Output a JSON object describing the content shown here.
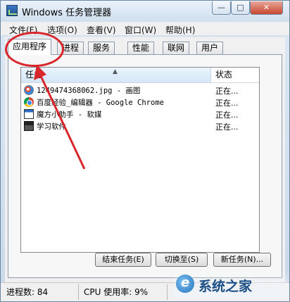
{
  "window": {
    "title": "Windows 任务管理器",
    "controls": {
      "minimize": "—",
      "maximize": "□",
      "close": "✕"
    }
  },
  "menubar": {
    "items": [
      "文件(F)",
      "选项(O)",
      "查看(V)",
      "窗口(W)",
      "帮助(H)"
    ]
  },
  "tabs": [
    "应用程序",
    "进程",
    "服务",
    "性能",
    "联网",
    "用户"
  ],
  "active_tab": "应用程序",
  "task_list": {
    "columns": {
      "task": "任务",
      "status": "状态"
    },
    "rows": [
      {
        "name": "1249474368062.jpg - 画图",
        "status": "正在...",
        "icon": "paint-icon"
      },
      {
        "name": "百度经验_编辑器 - Google Chrome",
        "status": "正在...",
        "icon": "chrome-icon"
      },
      {
        "name": "魔方小助手 - 软媒",
        "status": "正在...",
        "icon": "window-icon"
      },
      {
        "name": "学习软件",
        "status": "正在...",
        "icon": "app-window-icon"
      }
    ]
  },
  "buttons": {
    "end_task": "结束任务(E)",
    "switch_to": "切换至(S)",
    "new_task": "新任务(N)..."
  },
  "statusbar": {
    "processes": "进程数: 84",
    "cpu": "CPU 使用率: 9%"
  },
  "watermark": {
    "text": "系统之家"
  },
  "annotation": {
    "color": "#d9262b"
  }
}
